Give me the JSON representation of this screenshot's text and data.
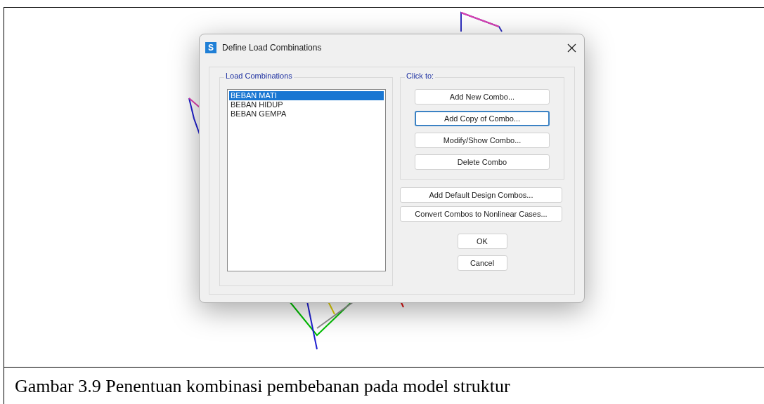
{
  "dialog": {
    "title": "Define Load Combinations",
    "app_icon": "S",
    "combinations": {
      "label": "Load Combinations",
      "items": [
        {
          "label": "BEBAN MATI",
          "selected": true
        },
        {
          "label": "BEBAN HIDUP",
          "selected": false
        },
        {
          "label": "BEBAN GEMPA",
          "selected": false
        }
      ]
    },
    "click_to": {
      "label": "Click to:",
      "buttons": [
        {
          "label": "Add New Combo...",
          "focused": false
        },
        {
          "label": "Add Copy of Combo...",
          "focused": true
        },
        {
          "label": "Modify/Show Combo...",
          "focused": false
        },
        {
          "label": "Delete Combo",
          "focused": false
        }
      ]
    },
    "extra_buttons": [
      "Add Default Design Combos...",
      "Convert Combos to Nonlinear Cases..."
    ],
    "ok": "OK",
    "cancel": "Cancel"
  },
  "caption": "Gambar 3.9 Penentuan kombinasi pembebanan pada model struktur"
}
